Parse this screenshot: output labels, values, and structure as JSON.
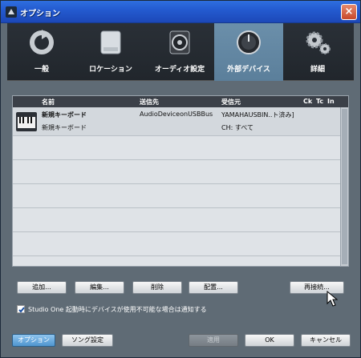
{
  "window": {
    "title": "オプション",
    "close_label": "×"
  },
  "tabs": [
    {
      "label": "一般",
      "icon": "refresh-icon"
    },
    {
      "label": "ロケーション",
      "icon": "drive-icon"
    },
    {
      "label": "オーディオ設定",
      "icon": "speaker-icon"
    },
    {
      "label": "外部デバイス",
      "icon": "knob-icon",
      "active": true
    },
    {
      "label": "詳細",
      "icon": "gears-icon"
    }
  ],
  "table": {
    "columns": [
      "名前",
      "送信先",
      "受信元",
      "Ck",
      "Tc",
      "In"
    ],
    "rows": [
      {
        "name": "新規キーボード",
        "send": "AudioDeviceonUSBBus",
        "receive": "YAMAHAUSBIN..ト済み]"
      },
      {
        "name": "新規キーボード",
        "send": "",
        "receive": "CH: すべて"
      }
    ]
  },
  "buttons": {
    "add": "追加...",
    "edit": "編集...",
    "delete": "削除",
    "place": "配置...",
    "reconnect": "再接続..."
  },
  "checkbox": {
    "label": "Studio One 起動時にデバイスが使用不可能な場合は通知する",
    "checked": true
  },
  "footer": {
    "options": "オプション",
    "song_settings": "ソング設定",
    "apply": "適用",
    "ok": "OK",
    "cancel": "キャンセル"
  }
}
